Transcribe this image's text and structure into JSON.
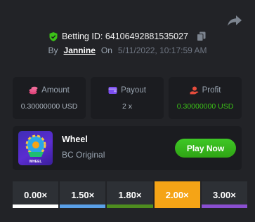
{
  "header": {
    "bet_id_label": "Betting ID:",
    "bet_id": "64106492881535027",
    "by_label": "By",
    "username": "Jannine",
    "on_label": "On",
    "datetime": "5/11/2022, 10:17:59 AM"
  },
  "stats": [
    {
      "label": "Amount",
      "value": "0.30000000 USD",
      "icon": "coins-icon",
      "color": "#e0457b"
    },
    {
      "label": "Payout",
      "value": "2 x",
      "icon": "wallet-icon",
      "color": "#7c4ef0"
    },
    {
      "label": "Profit",
      "value": "0.30000000 USD",
      "icon": "profit-icon",
      "color": "#e74c3c",
      "value_color": "#3bc117"
    }
  ],
  "game": {
    "name": "Wheel",
    "provider": "BC Original",
    "play_label": "Play Now",
    "thumb_text": "WHEEL"
  },
  "multipliers": [
    {
      "label": "0.00×",
      "color": "#ffffff",
      "active": false
    },
    {
      "label": "1.50×",
      "color": "#5aa0e8",
      "active": false
    },
    {
      "label": "1.80×",
      "color": "#4e8d1f",
      "active": false
    },
    {
      "label": "2.00×",
      "color": "#f5a416",
      "active": true
    },
    {
      "label": "3.00×",
      "color": "#8a4fd0",
      "active": false
    }
  ],
  "colors": {
    "background": "#222327",
    "card": "#1b1c20",
    "accent_green": "#3bc117",
    "active_multiplier": "#f5a416"
  }
}
